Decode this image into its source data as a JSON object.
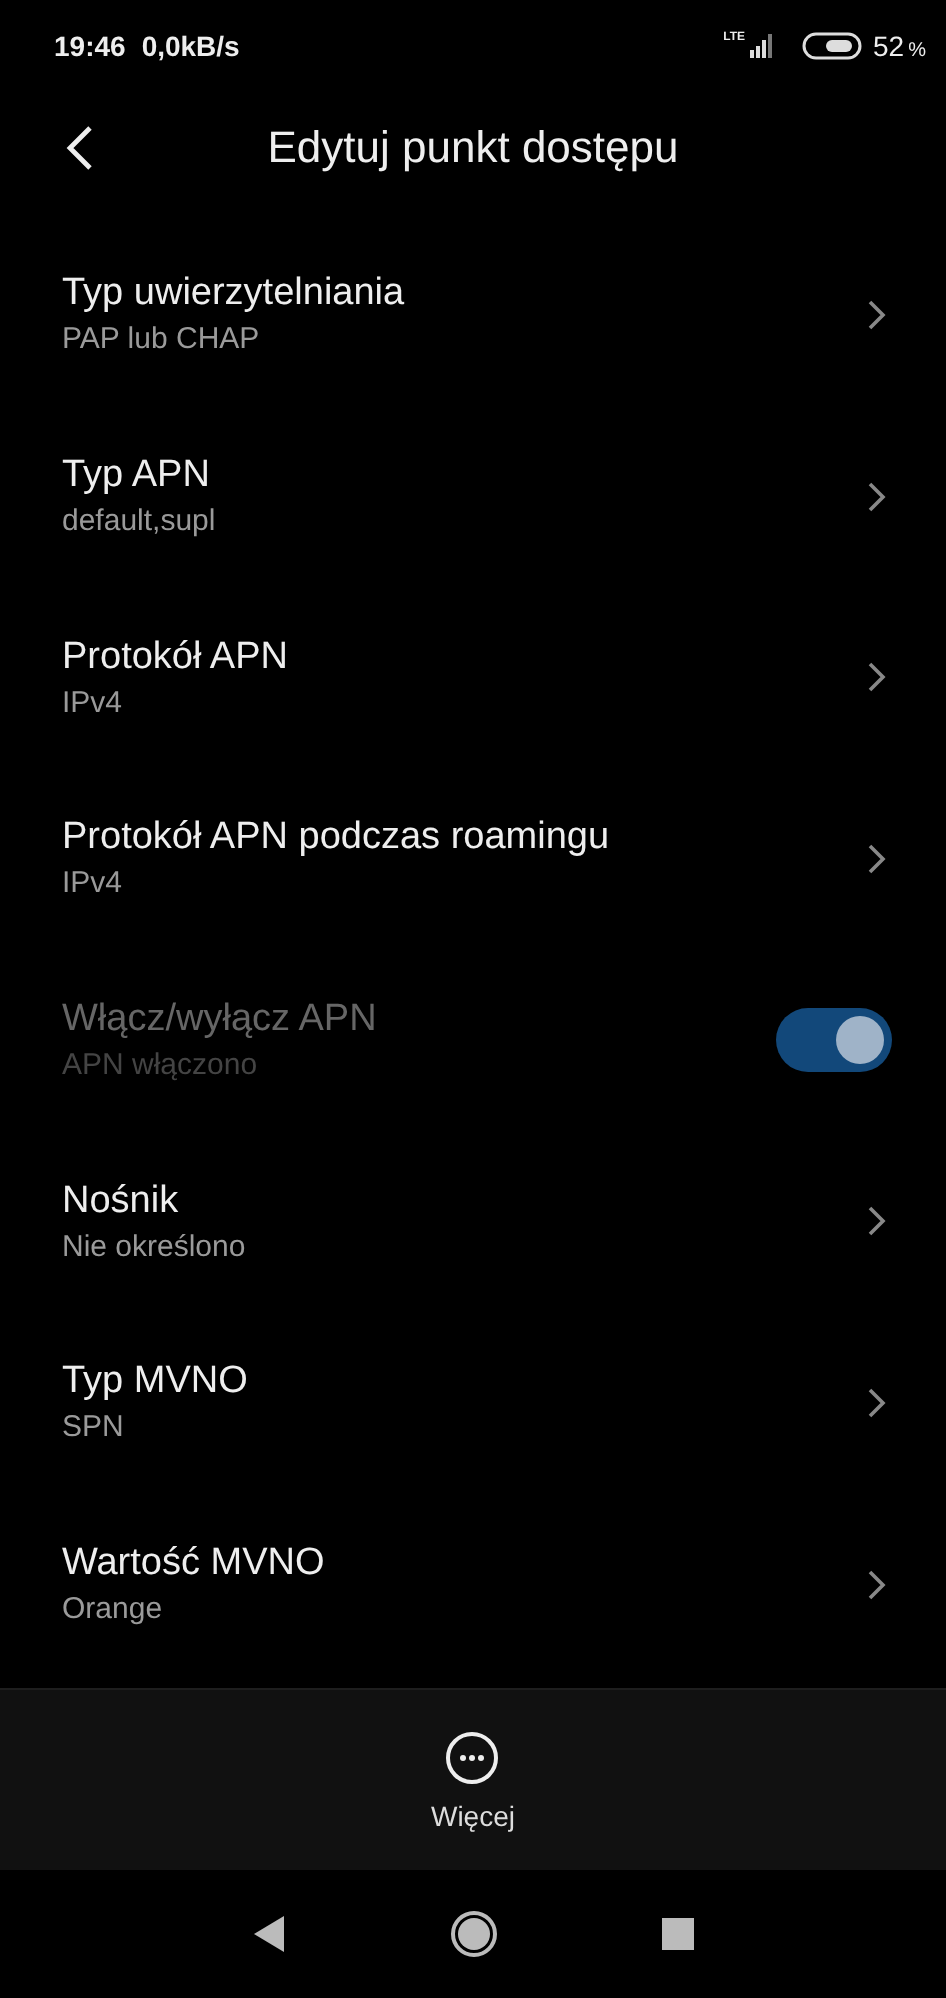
{
  "status_bar": {
    "time": "19:46",
    "speed": "0,0kB/s",
    "network": "LTE",
    "battery_percent": "52",
    "battery_unit": "%"
  },
  "header": {
    "title": "Edytuj punkt dostępu"
  },
  "items": [
    {
      "kind": "link",
      "title": "Typ uwierzytelniania",
      "value": "PAP lub CHAP",
      "disabled": false
    },
    {
      "kind": "link",
      "title": "Typ APN",
      "value": "default,supl",
      "disabled": false
    },
    {
      "kind": "link",
      "title": "Protokół APN",
      "value": "IPv4",
      "disabled": false
    },
    {
      "kind": "link",
      "title": "Protokół APN podczas roamingu",
      "value": "IPv4",
      "disabled": false
    },
    {
      "kind": "toggle",
      "title": "Włącz/wyłącz APN",
      "value": "APN włączono",
      "disabled": true,
      "on": true
    },
    {
      "kind": "link",
      "title": "Nośnik",
      "value": "Nie określono",
      "disabled": false
    },
    {
      "kind": "link",
      "title": "Typ MVNO",
      "value": "SPN",
      "disabled": false
    },
    {
      "kind": "link",
      "title": "Wartość MVNO",
      "value": "Orange",
      "disabled": false
    }
  ],
  "bottom_bar": {
    "more_label": "Więcej"
  }
}
